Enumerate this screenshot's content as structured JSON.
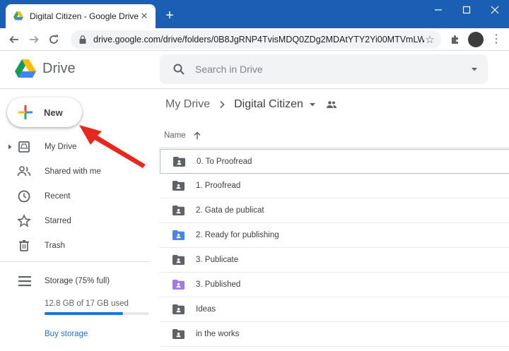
{
  "browser": {
    "tab_title": "Digital Citizen - Google Drive",
    "new_tab_symbol": "+",
    "url": "drive.google.com/drive/folders/0B8JgRNP4TvisMDQ0ZDg2MDAtYTY2Yi00MTVmLWI1"
  },
  "header": {
    "app_name": "Drive",
    "search_placeholder": "Search in Drive"
  },
  "sidebar": {
    "new_label": "New",
    "items": [
      {
        "label": "My Drive",
        "icon": "my-drive-icon"
      },
      {
        "label": "Shared with me",
        "icon": "shared-with-me-icon"
      },
      {
        "label": "Recent",
        "icon": "clock-icon"
      },
      {
        "label": "Starred",
        "icon": "star-icon"
      },
      {
        "label": "Trash",
        "icon": "trash-icon"
      }
    ],
    "storage": {
      "label": "Storage (75% full)",
      "used_text": "12.8 GB of 17 GB used",
      "fill_fraction": 0.75,
      "buy_label": "Buy storage"
    }
  },
  "main": {
    "breadcrumb_root": "My Drive",
    "breadcrumb_current": "Digital Citizen",
    "column_name": "Name",
    "files": [
      {
        "name": "0. To Proofread",
        "color": "#5f6368",
        "selected": true
      },
      {
        "name": "1. Proofread",
        "color": "#5f6368",
        "selected": false
      },
      {
        "name": "2. Gata de publicat",
        "color": "#5f6368",
        "selected": false
      },
      {
        "name": "2. Ready for publishing",
        "color": "#4a86e8",
        "selected": false
      },
      {
        "name": "3. Publicate",
        "color": "#5f6368",
        "selected": false
      },
      {
        "name": "3. Published",
        "color": "#a479e2",
        "selected": false
      },
      {
        "name": "Ideas",
        "color": "#5f6368",
        "selected": false
      },
      {
        "name": "in the works",
        "color": "#5f6368",
        "selected": false
      }
    ]
  },
  "colors": {
    "titlebar": "#1a5fb4",
    "accent": "#1a73e8",
    "annotation_arrow": "#e8281e"
  }
}
